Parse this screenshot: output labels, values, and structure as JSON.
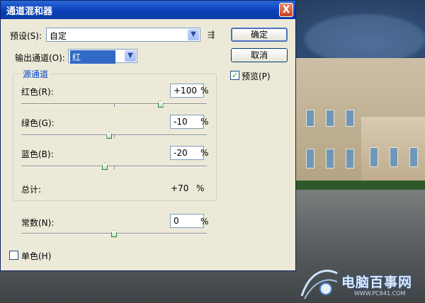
{
  "dialog": {
    "title": "通道混和器",
    "close_label": "X",
    "preset_label": "预设(S):",
    "preset_value": "自定",
    "output_label": "输出通道(O):",
    "output_value": "红",
    "group_title": "源通道",
    "channels": [
      {
        "label": "红色(R):",
        "value": "+100",
        "unit": "%",
        "slider_percent": 100
      },
      {
        "label": "绿色(G):",
        "value": "-10",
        "unit": "%",
        "slider_percent": -10
      },
      {
        "label": "蓝色(B):",
        "value": "-20",
        "unit": "%",
        "slider_percent": -20
      }
    ],
    "total_label": "总计:",
    "total_value": "+70",
    "total_unit": "%",
    "constant": {
      "label": "常数(N):",
      "value": "0",
      "unit": "%",
      "slider_percent": 0
    },
    "ok_label": "确定",
    "cancel_label": "取消",
    "preview_label": "预览(P)",
    "preview_checked": true,
    "mono_label": "单色(H)",
    "mono_checked": false
  },
  "watermark": {
    "text": "电脑百事网",
    "url": "WWW.PC841.COM"
  },
  "colors": {
    "title_blue": "#0a3fb8",
    "dialog_bg": "#ece9d8",
    "group_title": "#0046d5",
    "selection": "#316ac5"
  }
}
